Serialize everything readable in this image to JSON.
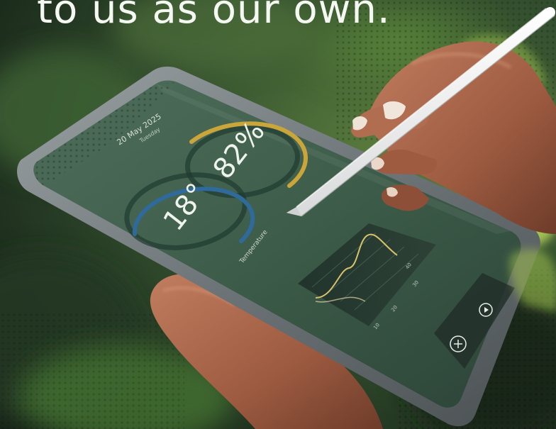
{
  "headline": {
    "text": "to us as our own."
  },
  "tablet": {
    "date_text": "20 May 2025",
    "sub_date_text": "Tuesday",
    "temperature_text": "18°",
    "humidity_text": "82%",
    "section_label": "Temperature",
    "chart_tick_labels": [
      "40",
      "30",
      "20",
      "10"
    ]
  },
  "colors": {
    "foliage_dark": "#1d2a1e",
    "foliage_light": "#6d9a3c",
    "screen": "#3f5e4a",
    "temperature_ring": "#2f6a9a",
    "humidity_ring": "#c9a53a",
    "chart_line": "#d8c36a",
    "stylus": "#f2f2f2",
    "skin": "#a5644a"
  }
}
